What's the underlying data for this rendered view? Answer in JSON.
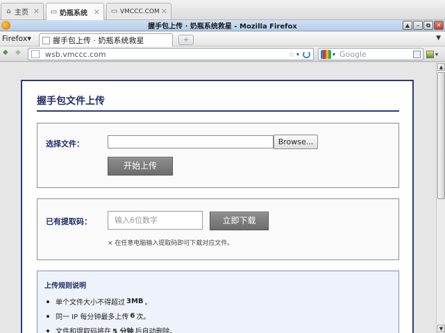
{
  "outer_tabs": [
    {
      "label": "主页",
      "icon": "home-icon",
      "active": false
    },
    {
      "label": "奶瓶系统",
      "icon": "page-icon",
      "active": true
    },
    {
      "label": "VMCCC.COM",
      "icon": "page-icon",
      "active": false
    }
  ],
  "window": {
    "title": "握手包上传 · 奶瓶系统救星 - Mozilla Firefox",
    "controls": [
      "▲",
      "–",
      "⧉",
      "✕"
    ]
  },
  "menu": {
    "firefox_label": "Firefox▾",
    "tab_label": "握手包上传 · 奶瓶系统救星",
    "new_tab": "+",
    "tabs_dropdown": "▼"
  },
  "nav": {
    "back": "◆",
    "forward": "◆",
    "url": "wsb.vmccc.com",
    "bookmark_star": "☆",
    "dropdown": "▾",
    "search_placeholder": "Google",
    "search_dropdown": "▾"
  },
  "page": {
    "title": "握手包文件上传",
    "upload": {
      "label": "选择文件：",
      "browse_label": "Browse...",
      "submit_label": "开始上传"
    },
    "download": {
      "label": "已有提取码：",
      "placeholder": "输入6位数字",
      "button_label": "立即下载",
      "hint": "× 在任意电脑输入提取码即可下载对应文件。"
    },
    "rules": {
      "title": "上传规则说明",
      "items": [
        {
          "pre": "单个文件大小不得超过",
          "strong": "3MB",
          "post": "。"
        },
        {
          "pre": "同一 IP 每分钟最多上传",
          "strong": "6",
          "post": "次。"
        },
        {
          "pre": "文件和提取码将在",
          "strong": "5 分钟",
          "post": "后自动删除。"
        }
      ]
    }
  },
  "colors": {
    "brand_navy": "#1f2d66",
    "button_gray": "#7d7d7d",
    "rules_bg": "#eef2fa"
  }
}
